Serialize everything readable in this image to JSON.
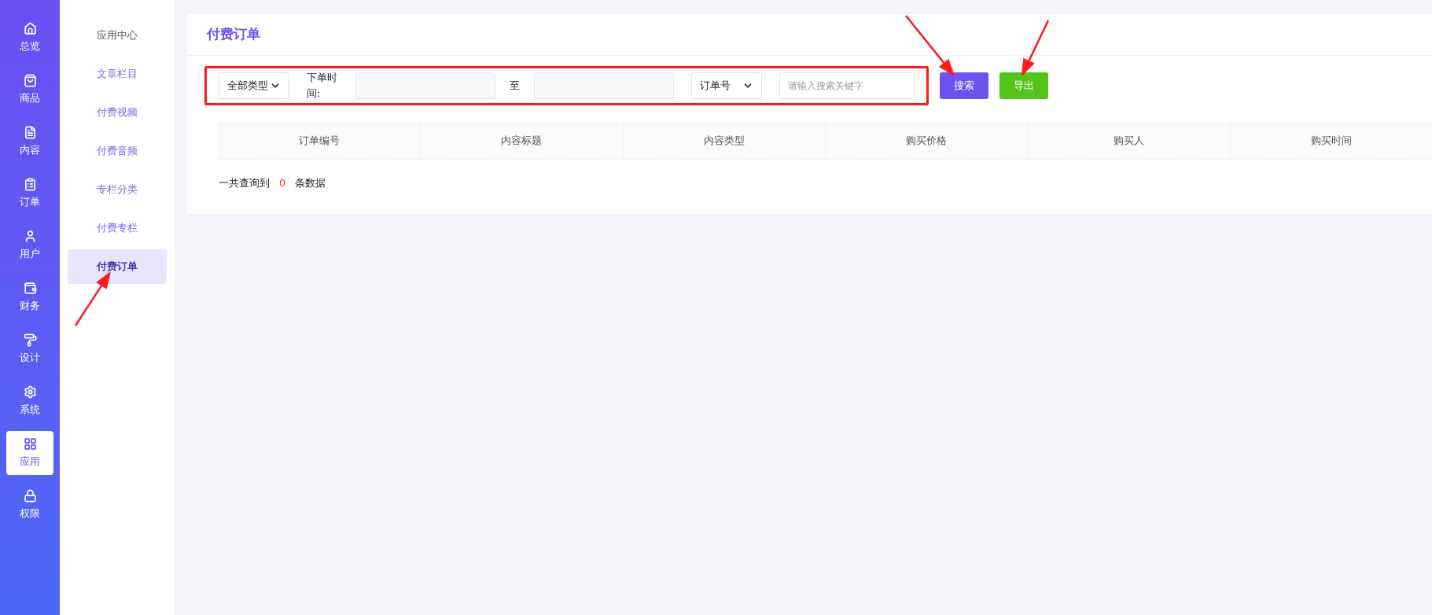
{
  "nav": [
    {
      "label": "总览",
      "selected": false
    },
    {
      "label": "商品",
      "selected": false
    },
    {
      "label": "内容",
      "selected": false
    },
    {
      "label": "订单",
      "selected": false
    },
    {
      "label": "用户",
      "selected": false
    },
    {
      "label": "财务",
      "selected": false
    },
    {
      "label": "设计",
      "selected": false
    },
    {
      "label": "系统",
      "selected": false
    },
    {
      "label": "应用",
      "selected": true
    },
    {
      "label": "权限",
      "selected": false
    }
  ],
  "subnav": [
    {
      "label": "应用中心",
      "selected": false
    },
    {
      "label": "文章栏目",
      "selected": false
    },
    {
      "label": "付费视频",
      "selected": false
    },
    {
      "label": "付费音频",
      "selected": false
    },
    {
      "label": "专栏分类",
      "selected": false
    },
    {
      "label": "付费专栏",
      "selected": false
    },
    {
      "label": "付费订单",
      "selected": true
    }
  ],
  "page_title": "付费订单",
  "filters": {
    "type_select": "全部类型",
    "time_label": "下单时间:",
    "range_separator": "至",
    "field_select": "订单号",
    "keyword": {
      "placeholder": "请输入搜索关键字"
    }
  },
  "buttons": {
    "search": "搜索",
    "export": "导出"
  },
  "table": {
    "columns": [
      "订单编号",
      "内容标题",
      "内容类型",
      "购买价格",
      "购买人",
      "购买时间"
    ]
  },
  "summary": {
    "prefix": "一共查询到",
    "count": "0",
    "suffix": "条数据"
  }
}
